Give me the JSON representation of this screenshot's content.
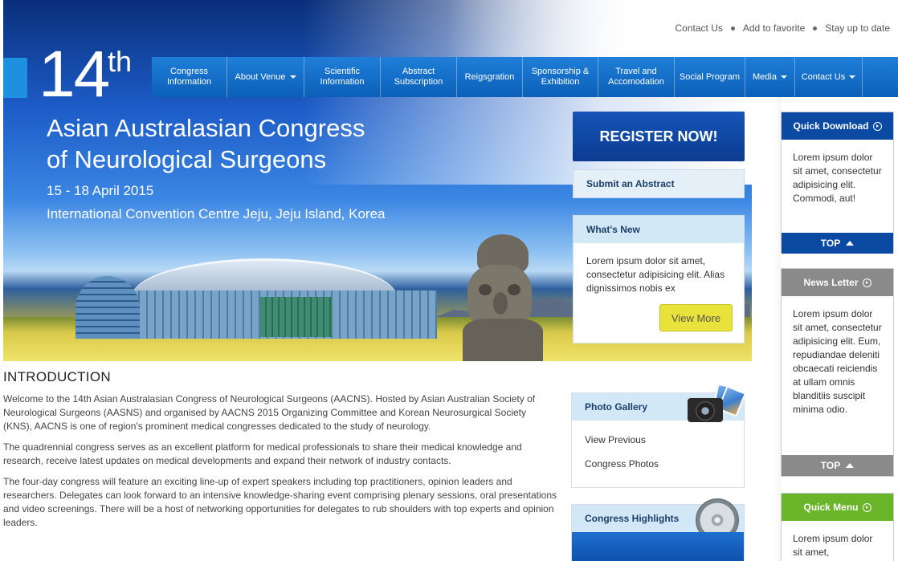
{
  "hero": {
    "number": "14",
    "suffix": "th",
    "title_line1": "Asian Australasian Congress",
    "title_line2": "of Neurological Surgeons",
    "date": "15 - 18 April 2015",
    "venue": "International Convention Centre Jeju, Jeju Island, Korea"
  },
  "toplinks": [
    "Contact Us",
    "Add to favorite",
    "Stay up to date"
  ],
  "nav": [
    {
      "label_line1": "Congress",
      "label_line2": "Information",
      "dropdown": false
    },
    {
      "label_line1": "About Venue",
      "label_line2": "",
      "dropdown": true
    },
    {
      "label_line1": "Scientific",
      "label_line2": "Information",
      "dropdown": false
    },
    {
      "label_line1": "Abstract",
      "label_line2": "Subscription",
      "dropdown": false
    },
    {
      "label_line1": "Reigsgration",
      "label_line2": "",
      "dropdown": false
    },
    {
      "label_line1": "Sponsorship &",
      "label_line2": "Exhibition",
      "dropdown": false
    },
    {
      "label_line1": "Travel and",
      "label_line2": "Accomodation",
      "dropdown": false
    },
    {
      "label_line1": "Social Program",
      "label_line2": "",
      "dropdown": false
    },
    {
      "label_line1": "Media",
      "label_line2": "",
      "dropdown": true
    },
    {
      "label_line1": "Contact Us",
      "label_line2": "",
      "dropdown": true
    }
  ],
  "register": {
    "label": "REGISTER NOW!"
  },
  "submit_abstract": {
    "label": "Submit an Abstract"
  },
  "whats_new": {
    "title": "What's New",
    "text": "Lorem ipsum dolor sit amet, consectetur adipisicing elit. Alias dignissimos nobis ex",
    "button": "View More"
  },
  "photo_gallery": {
    "title": "Photo Gallery",
    "links": [
      "View Previous",
      "Congress Photos"
    ]
  },
  "congress_highlights": {
    "title": "Congress Highlights"
  },
  "intro": {
    "title": "INTRODUCTION",
    "paragraphs": [
      "Welcome to the 14th Asian Australasian Congress of Neurological Surgeons (AACNS). Hosted by Asian Australian Society of Neurological Surgeons (AASNS) and organised by AACNS 2015 Organizing Committee and Korean Neurosurgical Society (KNS), AACNS is one of region's prominent medical congresses dedicated to the study of neurology.",
      "The quadrennial congress serves as an excellent platform for medical professionals to share their medical knowledge and research, receive latest updates on medical developments and expand their network of industry contacts.",
      "The four-day congress will feature an exciting line-up of expert speakers including top practitioners, opinion leaders and researchers. Delegates can look forward to an intensive knowledge-sharing event comprising plenary sessions, oral presentations and video screenings. There will be a host of networking opportunities for delegates to rub shoulders with top experts and opinion leaders."
    ]
  },
  "sidebar": {
    "quick_download": {
      "title": "Quick Download",
      "text": "Lorem ipsum dolor sit amet, consectetur adipisicing elit. Commodi, aut!",
      "top": "TOP",
      "color": "#0b4aa2"
    },
    "news_letter": {
      "title": "News Letter",
      "text": "Lorem ipsum dolor sit amet, consectetur adipisicing elit. Eum, repudiandae deleniti obcaecati reiciendis at ullam omnis blanditiis suscipit minima odio.",
      "top": "TOP",
      "color": "#8a8a8a"
    },
    "quick_menu": {
      "title": "Quick Menu",
      "text": "Lorem ipsum dolor sit amet,",
      "color": "#6ab42a"
    }
  }
}
